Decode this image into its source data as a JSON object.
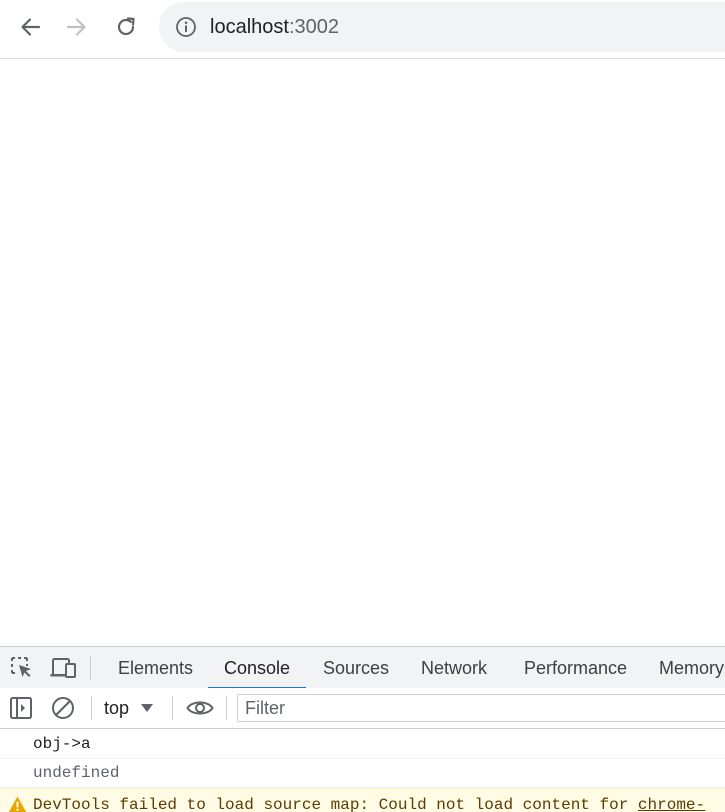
{
  "browser": {
    "url_host": "localhost",
    "url_port": ":3002",
    "icons": {
      "back": "back-arrow-icon",
      "forward": "forward-arrow-icon",
      "reload": "reload-icon",
      "site_info": "info-icon"
    }
  },
  "devtools": {
    "tabs": [
      {
        "label": "Elements",
        "active": false
      },
      {
        "label": "Console",
        "active": true
      },
      {
        "label": "Sources",
        "active": false
      },
      {
        "label": "Network",
        "active": false
      },
      {
        "label": "Performance",
        "active": false
      },
      {
        "label": "Memory",
        "active": false
      }
    ],
    "accent_color": "#1a73e8",
    "console_toolbar": {
      "context": "top",
      "filter_placeholder": "Filter"
    },
    "messages": [
      {
        "type": "log",
        "text": "obj->a"
      },
      {
        "type": "result",
        "text": "undefined"
      },
      {
        "type": "warning",
        "text": "DevTools failed to load source map: Could not load content for ",
        "link": "chrome-"
      }
    ]
  }
}
